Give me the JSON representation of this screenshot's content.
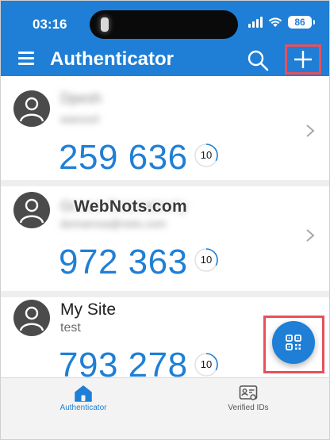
{
  "status_bar": {
    "time": "03:16",
    "battery": "86",
    "icons": [
      "cellular-signal-icon",
      "wifi-icon",
      "battery-icon"
    ]
  },
  "app_bar": {
    "title": "Authenticator",
    "icons": [
      "menu-icon",
      "search-icon",
      "add-icon"
    ]
  },
  "accounts": [
    {
      "name": "Dpesh",
      "subtitle": "wanoorl",
      "code": "259 636",
      "timer": "10",
      "timer_fraction": 0.33,
      "redacted": true
    },
    {
      "name": "Grreos Dooreatrerty",
      "subtitle": "domarnsa@nets.com",
      "code": "972 363",
      "timer": "10",
      "timer_fraction": 0.33,
      "redacted": true
    },
    {
      "name": "My Site",
      "subtitle": "test",
      "code": "793 278",
      "timer": "10",
      "timer_fraction": 0.33,
      "redacted": false
    }
  ],
  "watermark": "WebNots.com",
  "fab": {
    "icon": "qr-scan-icon"
  },
  "tabs": [
    {
      "label": "Authenticator",
      "icon": "home-icon",
      "active": true
    },
    {
      "label": "Verified IDs",
      "icon": "id-card-icon",
      "active": false
    }
  ],
  "colors": {
    "brand": "#1f7fd6",
    "highlight": "#e8505b",
    "avatar": "#4b4b4b"
  }
}
